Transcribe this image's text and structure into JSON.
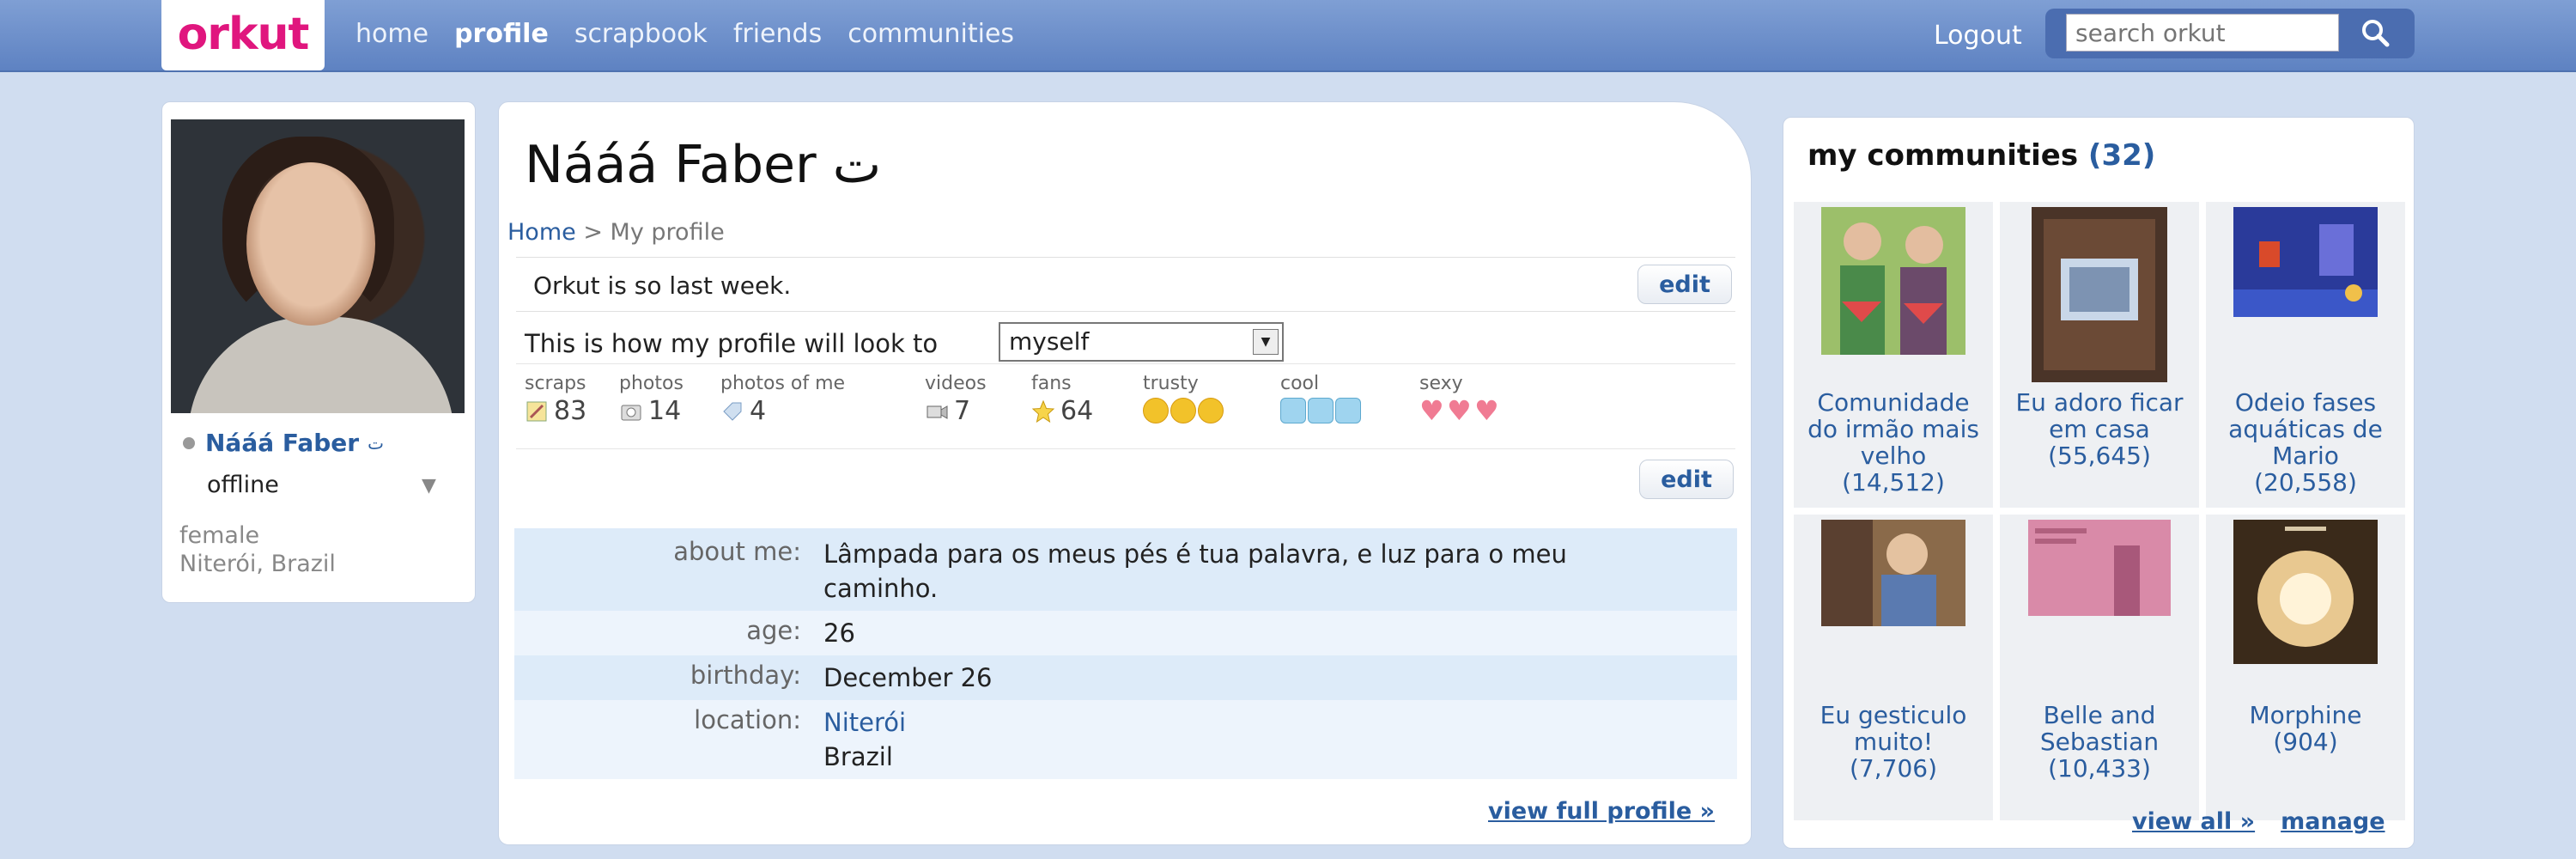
{
  "app": {
    "logo_text": "orkut",
    "nav": [
      "home",
      "profile",
      "scrapbook",
      "friends",
      "communities"
    ],
    "active_nav": "profile",
    "logout_label": "Logout",
    "search_placeholder": "search orkut"
  },
  "sidebar": {
    "name": "Nááá Faber",
    "name_suffix": "ت",
    "status": "offline",
    "gender": "female",
    "city": "Niterói, Brazil"
  },
  "profile": {
    "title": "Nááá Faber ت",
    "breadcrumb_home": "Home",
    "breadcrumb_sep": ">",
    "breadcrumb_current": "My profile",
    "status_message": "Orkut is so last week.",
    "edit_label": "edit",
    "look_as_label": "This is how my profile will look to",
    "look_as_value": "myself",
    "stats": {
      "scraps_label": "scraps",
      "scraps": "83",
      "photos_label": "photos",
      "photos": "14",
      "photos_of_me_label": "photos of me",
      "photos_of_me": "4",
      "videos_label": "videos",
      "videos": "7",
      "fans_label": "fans",
      "fans": "64",
      "trusty_label": "trusty",
      "trusty_level": 3,
      "cool_label": "cool",
      "cool_level": 3,
      "sexy_label": "sexy",
      "sexy_level": 3
    },
    "about": {
      "about_label": "about me:",
      "about_value_line1": "Lâmpada para os meus pés é tua palavra, e luz para o meu",
      "about_value_line2": "caminho.",
      "age_label": "age:",
      "age_value": "26",
      "birthday_label": "birthday:",
      "birthday_value": "December 26",
      "location_label": "location:",
      "location_city": "Niterói",
      "location_country": "Brazil"
    },
    "view_full_label": "view full profile »"
  },
  "communities": {
    "title": "my communities",
    "count": "(32)",
    "items": [
      {
        "name_line1": "Comunidade",
        "name_line2": "do irmão mais",
        "name_line3": "velho",
        "members": "(14,512)"
      },
      {
        "name_line1": "Eu adoro ficar",
        "name_line2": "em casa",
        "name_line3": "",
        "members": "(55,645)"
      },
      {
        "name_line1": "Odeio fases",
        "name_line2": "aquáticas de",
        "name_line3": "Mario",
        "members": "(20,558)"
      },
      {
        "name_line1": "Eu gesticulo",
        "name_line2": "muito!",
        "name_line3": "",
        "members": "(7,706)"
      },
      {
        "name_line1": "Belle and",
        "name_line2": "Sebastian",
        "name_line3": "",
        "members": "(10,433)"
      },
      {
        "name_line1": "Morphine",
        "name_line2": "",
        "name_line3": "",
        "members": "(904)"
      }
    ],
    "view_all_label": "view all »",
    "manage_label": "manage"
  },
  "colors": {
    "background": "#d0ddf0",
    "topbar": "#6a8cca",
    "link": "#2a5d9f",
    "logo": "#e0167e"
  }
}
